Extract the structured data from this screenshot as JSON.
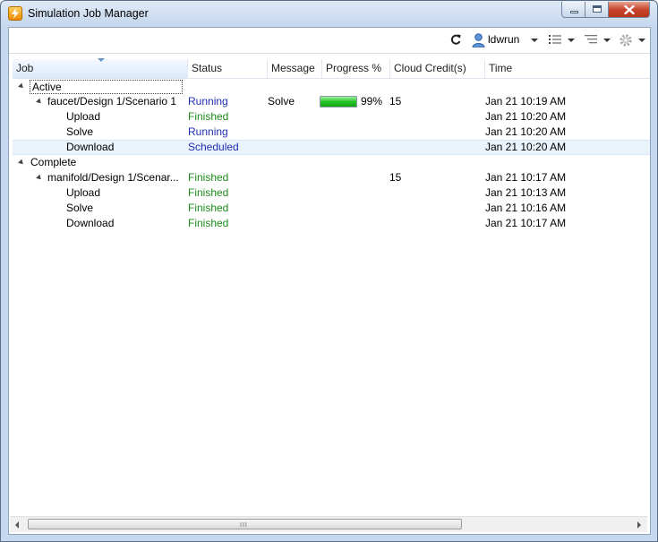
{
  "window": {
    "title": "Simulation Job Manager"
  },
  "toolbar": {
    "user": "ldwrun",
    "refresh_icon": "refresh-icon",
    "user_icon": "user-icon",
    "list_icon": "list-view-icon",
    "tree_icon": "tree-view-icon",
    "settings_icon": "gear-icon"
  },
  "columns": [
    "Job",
    "Status",
    "Message",
    "Progress %",
    "Cloud Credit(s)",
    "Time"
  ],
  "groups": [
    {
      "label": "Active",
      "jobs": [
        {
          "name": "faucet/Design 1/Scenario 1",
          "status": "Running",
          "message": "Solve",
          "progress": 99,
          "progress_label": "99%",
          "credits": "15",
          "time": "Jan 21 10:19 AM",
          "tasks": [
            {
              "name": "Upload",
              "status": "Finished",
              "time": "Jan 21 10:20 AM"
            },
            {
              "name": "Solve",
              "status": "Running",
              "time": "Jan 21 10:20 AM"
            },
            {
              "name": "Download",
              "status": "Scheduled",
              "time": "Jan 21 10:20 AM"
            }
          ]
        }
      ]
    },
    {
      "label": "Complete",
      "jobs": [
        {
          "name": "manifold/Design 1/Scenar...",
          "status": "Finished",
          "message": "",
          "progress": null,
          "progress_label": "",
          "credits": "15",
          "time": "Jan 21 10:17 AM",
          "tasks": [
            {
              "name": "Upload",
              "status": "Finished",
              "time": "Jan 21 10:13 AM"
            },
            {
              "name": "Solve",
              "status": "Finished",
              "time": "Jan 21 10:16 AM"
            },
            {
              "name": "Download",
              "status": "Finished",
              "time": "Jan 21 10:17 AM"
            }
          ]
        }
      ]
    }
  ],
  "scrollbar": {
    "grip": "III"
  },
  "colors": {
    "running": "#1f2fb0",
    "finished": "#1c8a1c",
    "progress": "#27c227",
    "selected_row": "#eaf3fc"
  }
}
